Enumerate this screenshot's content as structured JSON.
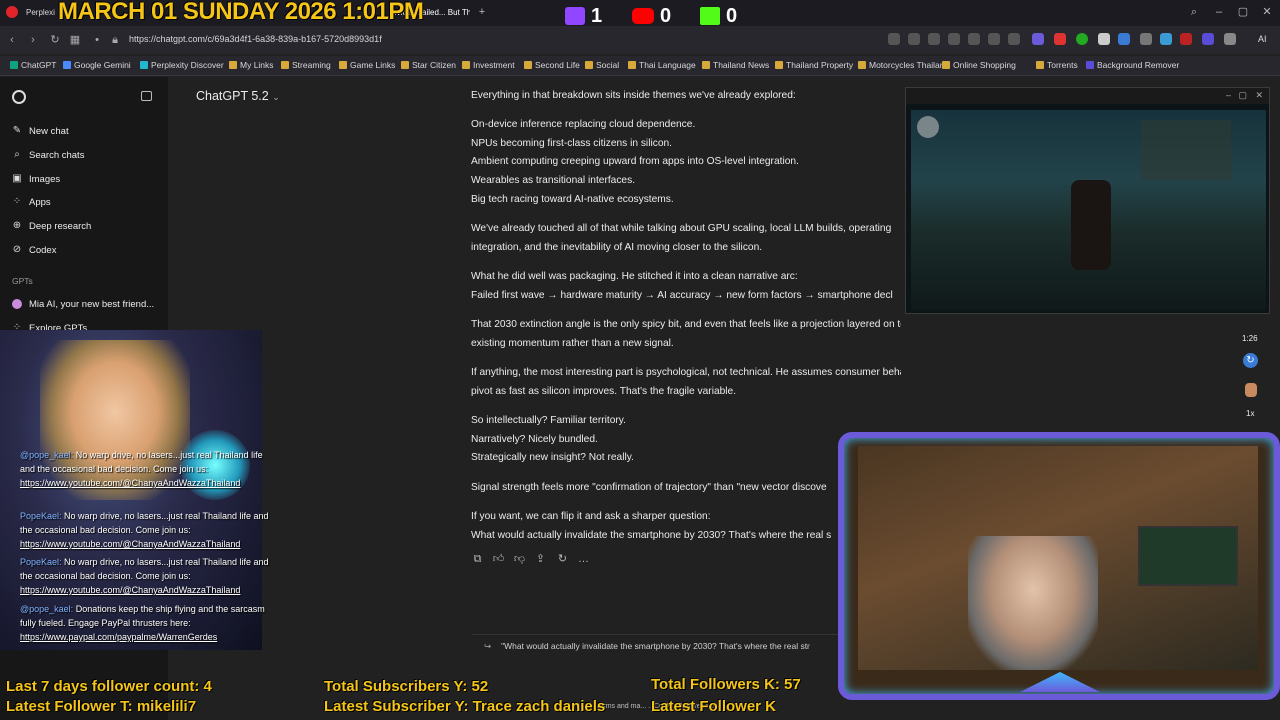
{
  "overlay": {
    "date_time": "MARCH 01 SUNDAY 2026 1:01PM",
    "twitch_count": "1",
    "youtube_count": "0",
    "kick_count": "0",
    "last7_followers": "Last 7 days follower count: 4",
    "latest_follower_t": "Latest Follower T: mikelili7",
    "total_subscribers_y": "Total Subscribers Y: 52",
    "latest_subscriber_y": "Latest Subscriber Y: Trace zach daniels",
    "total_followers_k": "Total Followers K: 57",
    "latest_follower_k": "Latest Follower K"
  },
  "tabs": [
    {
      "label": "Perplexi"
    },
    {
      "label": "...vices Failed... But Th"
    }
  ],
  "browser": {
    "url": "https://chatgpt.com/c/69a3d4f1-6a38-839a-b167-5720d8993d1f",
    "ai_label": "AI"
  },
  "bookmarks": [
    {
      "label": "ChatGPT"
    },
    {
      "label": "Google Gemini"
    },
    {
      "label": "Perplexity Discover"
    },
    {
      "label": "My Links"
    },
    {
      "label": "Streaming"
    },
    {
      "label": "Game Links"
    },
    {
      "label": "Star Citizen"
    },
    {
      "label": "Investment"
    },
    {
      "label": "Second Life"
    },
    {
      "label": "Social"
    },
    {
      "label": "Thai Language"
    },
    {
      "label": "Thailand News"
    },
    {
      "label": "Thailand Property"
    },
    {
      "label": "Motorcycles Thailand"
    },
    {
      "label": "Online Shopping"
    },
    {
      "label": "Torrents"
    },
    {
      "label": "Background Remover"
    }
  ],
  "sidebar": {
    "items": [
      {
        "label": "New chat",
        "icon": "pencil-icon"
      },
      {
        "label": "Search chats",
        "icon": "search-icon"
      },
      {
        "label": "Images",
        "icon": "image-icon"
      },
      {
        "label": "Apps",
        "icon": "apps-icon"
      },
      {
        "label": "Deep research",
        "icon": "telescope-icon"
      },
      {
        "label": "Codex",
        "icon": "code-icon"
      }
    ],
    "gpts_header": "GPTs",
    "gpt_items": [
      {
        "label": "Mia AI, your new best friend..."
      },
      {
        "label": "Explore GPTs"
      }
    ]
  },
  "model": {
    "label": "ChatGPT 5.2"
  },
  "chat": {
    "paragraphs": [
      [
        "Everything in that breakdown sits inside themes we've already explored:"
      ],
      [
        "On-device inference replacing cloud dependence.",
        "NPUs becoming first-class citizens in silicon.",
        "Ambient computing creeping upward from apps into OS-level integration.",
        "Wearables as transitional interfaces.",
        "Big tech racing toward AI-native ecosystems."
      ],
      [
        "We've already touched all of that while talking about GPU scaling, local LLM builds, operating",
        "integration, and the inevitability of AI moving closer to the silicon."
      ],
      [
        "What he did well was packaging. He stitched it into a clean narrative arc:",
        "Failed first wave → hardware maturity → AI accuracy → new form factors → smartphone decl"
      ],
      [
        "That 2030 extinction angle is the only spicy bit, and even that feels like a projection layered on top of",
        "existing momentum rather than a new signal."
      ],
      [
        "If anything, the most interesting part is psychological, not technical. He assumes consumer behavior will",
        "pivot as fast as silicon improves. That's the fragile variable."
      ],
      [
        "So intellectually? Familiar territory.",
        "Narratively? Nicely bundled.",
        "Strategically new insight? Not really."
      ],
      [
        "Signal strength feels more \"confirmation of trajectory\" than \"new vector discove"
      ],
      [
        "If you want, we can flip it and ask a sharper question:",
        "What would actually invalidate the smartphone by 2030? That's where the real s"
      ]
    ],
    "followup": "\"What would actually invalidate the smartphone by 2030? That's where the real str",
    "cookie_text": "Terms and ma... ...Cookie Preferences."
  },
  "overlay_chat": [
    {
      "name": "@pope_kael:",
      "text": " No warp drive, no lasers...just real Thailand life and the occasional bad decision. Come join us:",
      "link": "https://www.youtube.com/@ChanyaAndWazzaThailand"
    },
    {
      "name": "PopeKael:",
      "text": " No warp drive, no lasers...just real Thailand life and the occasional bad decision. Come join us:",
      "link": "https://www.youtube.com/@ChanyaAndWazzaThailand"
    },
    {
      "name": "PopeKael:",
      "text": " No warp drive, no lasers...just real Thailand life and the occasional bad decision. Come join us:",
      "link": "https://www.youtube.com/@ChanyaAndWazzaThailand"
    },
    {
      "name": "@pope_kael:",
      "text": " Donations keep the ship flying and the sarcasm fully fueled. Engage PayPal thrusters here:",
      "link": "https://www.paypal.com/paypalme/WarrenGerdes"
    }
  ],
  "media_controls": {
    "time": "1:26",
    "speed": "1x"
  },
  "colors": {
    "accent_yellow": "#f5c518",
    "twitch": "#9146ff",
    "youtube": "#ff0000",
    "kick": "#53fc18",
    "cam_frame": "#6b5bd8"
  }
}
